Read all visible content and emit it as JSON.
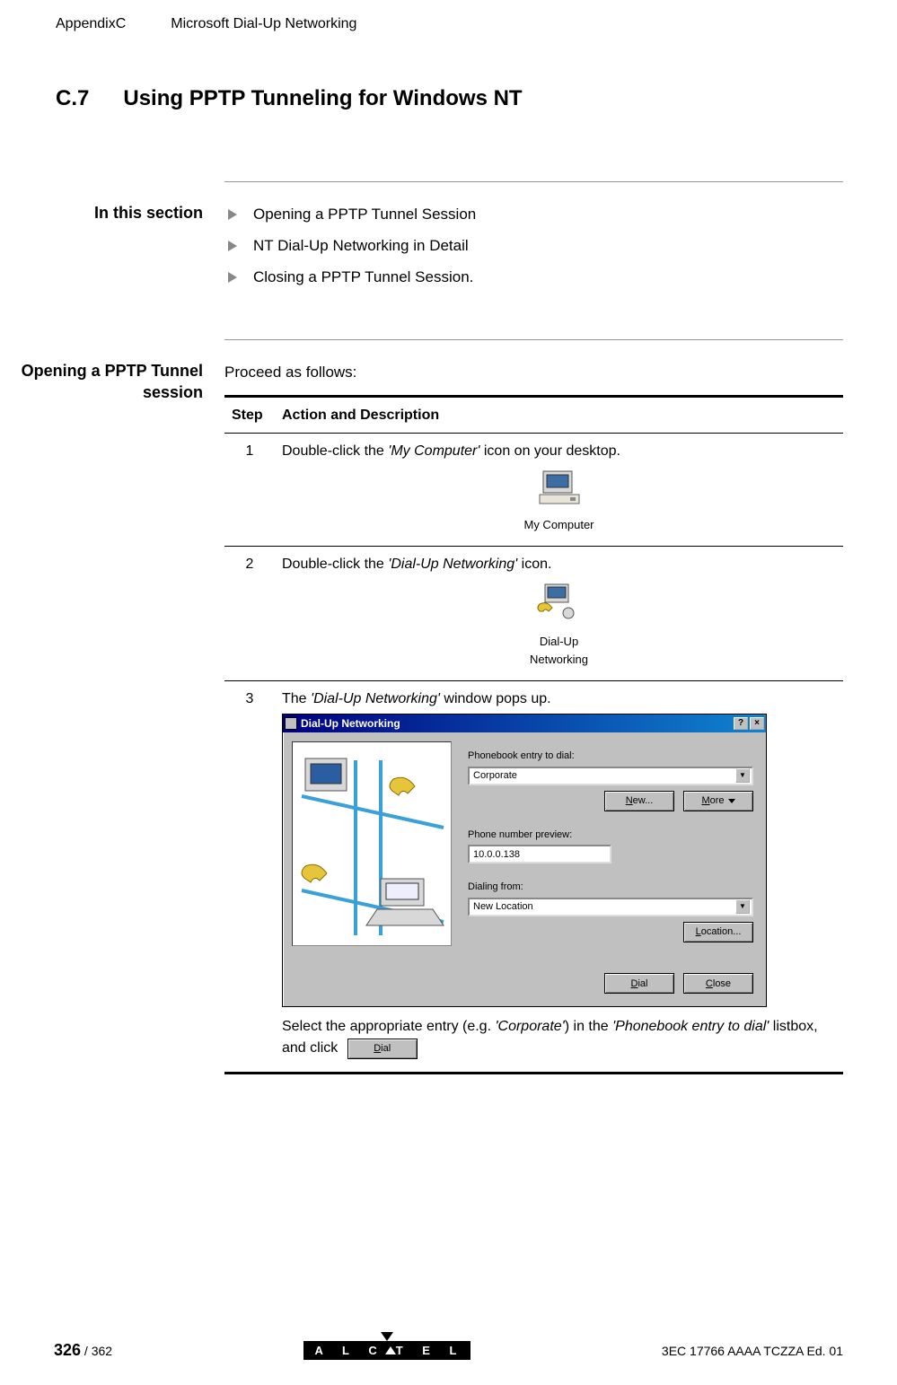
{
  "header": {
    "appendix": "AppendixC",
    "title": "Microsoft Dial-Up Networking"
  },
  "section": {
    "number": "C.7",
    "title": "Using PPTP Tunneling for Windows NT"
  },
  "in_this_section": {
    "label": "In this section",
    "items": [
      "Opening a PPTP Tunnel Session",
      "NT Dial-Up Networking in Detail",
      "Closing a PPTP Tunnel Session."
    ]
  },
  "procedure": {
    "label_line1": "Opening a PPTP Tunnel",
    "label_line2": "session",
    "intro": "Proceed as follows:",
    "headers": {
      "step": "Step",
      "action": "Action and Description"
    },
    "steps": [
      {
        "num": "1",
        "text_before": "Double-click the ",
        "text_italic": "'My Computer'",
        "text_after": " icon on your desktop.",
        "icon_label": "My Computer"
      },
      {
        "num": "2",
        "text_before": "Double-click the ",
        "text_italic": "'Dial-Up Networking'",
        "text_after": " icon.",
        "icon_label_l1": "Dial-Up",
        "icon_label_l2": "Networking"
      },
      {
        "num": "3",
        "text_before": "The ",
        "text_italic": "'Dial-Up Networking'",
        "text_after": " window pops up.",
        "post_before": "Select the appropriate entry (e.g. ",
        "post_italic1": "'Corporate'",
        "post_mid": ") in the ",
        "post_italic2": "'Phonebook entry to dial'",
        "post_after": " listbox, and click"
      }
    ]
  },
  "dun_window": {
    "title": "Dial-Up Networking",
    "labels": {
      "phonebook": "Phonebook entry to dial:",
      "phone_preview": "Phone number preview:",
      "dialing_from": "Dialing from:"
    },
    "values": {
      "phonebook_entry": "Corporate",
      "phone_number": "10.0.0.138",
      "location": "New Location"
    },
    "buttons": {
      "new": "New...",
      "more": "More",
      "location": "Location...",
      "dial": "Dial",
      "close": "Close",
      "help": "?",
      "x": "×"
    }
  },
  "footer": {
    "page": "326",
    "total": " / 362",
    "brand": "ALCATEL",
    "doc_id": "3EC 17766 AAAA TCZZA Ed. 01"
  }
}
